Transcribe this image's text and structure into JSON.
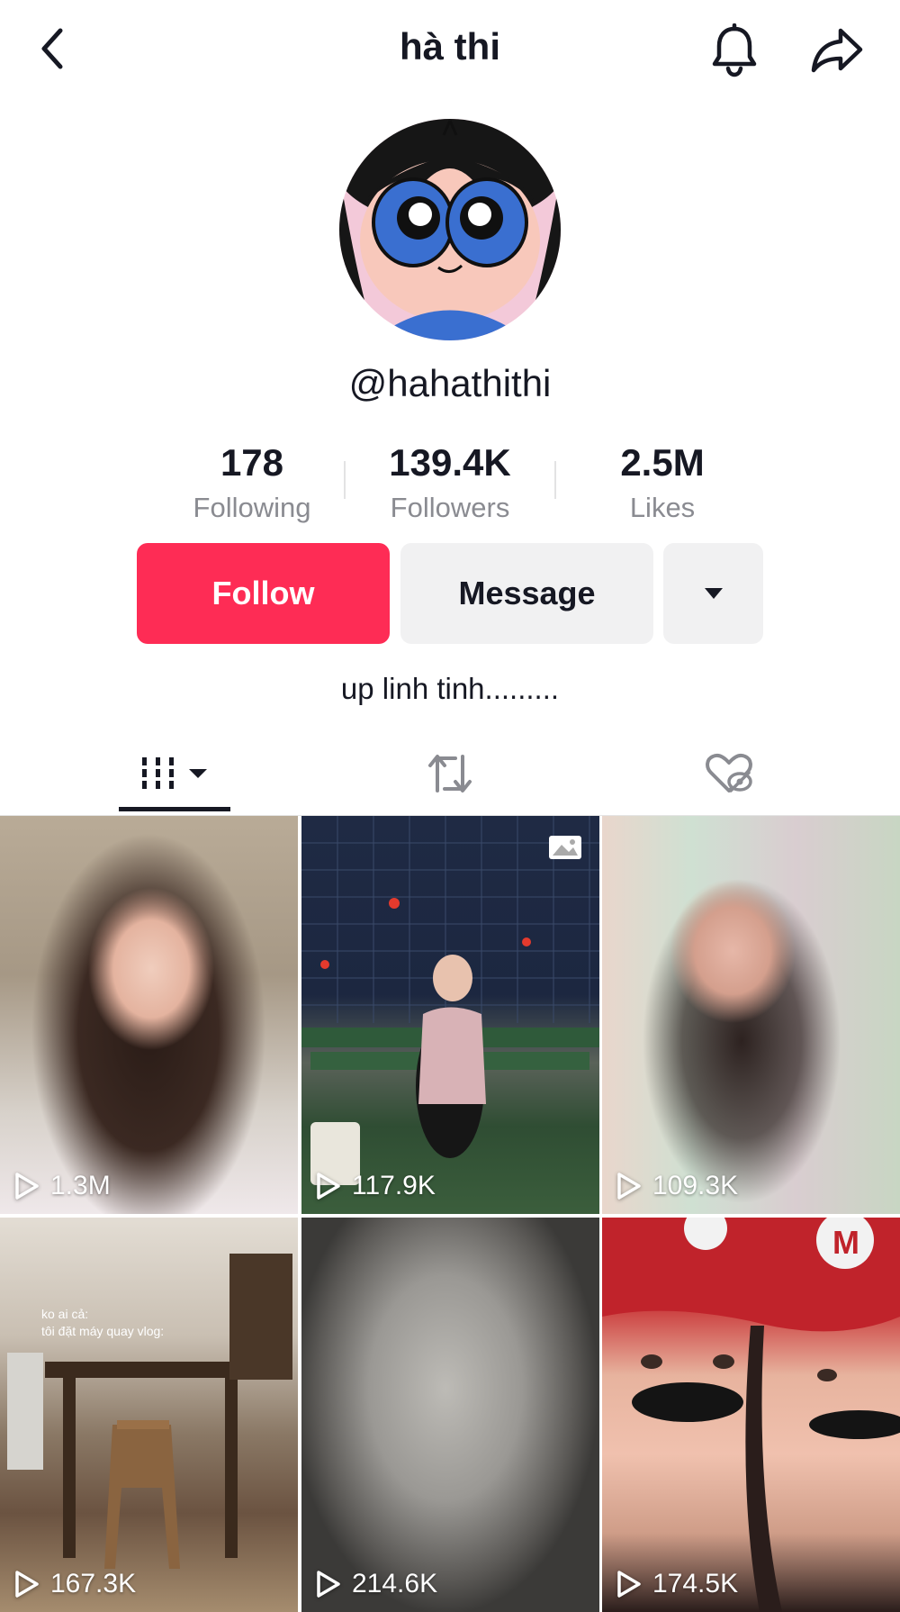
{
  "header": {
    "title": "hà thi",
    "back_icon": "chevron-left-icon",
    "bell_icon": "bell-icon",
    "share_icon": "share-arrow-icon"
  },
  "profile": {
    "handle": "@hahathithi",
    "avatar_icon": "cartoon-avatar",
    "bio": "up linh tinh........."
  },
  "stats": [
    {
      "value": "178",
      "label": "Following"
    },
    {
      "value": "139.4K",
      "label": "Followers"
    },
    {
      "value": "2.5M",
      "label": "Likes"
    }
  ],
  "actions": {
    "follow_label": "Follow",
    "message_label": "Message",
    "more_icon": "caret-down-icon"
  },
  "tabs": [
    {
      "name": "videos",
      "icon": "grid-bars-icon",
      "active": true
    },
    {
      "name": "reposts",
      "icon": "repost-icon",
      "active": false
    },
    {
      "name": "liked",
      "icon": "heart-hidden-icon",
      "active": false
    }
  ],
  "videos": [
    {
      "views": "1.3M"
    },
    {
      "views": "117.9K",
      "photo_icon": "photo-icon"
    },
    {
      "views": "109.3K"
    },
    {
      "views": "167.3K",
      "caption_line1": "ko ai cả:",
      "caption_line2": "tôi đặt máy quay vlog:"
    },
    {
      "views": "214.6K"
    },
    {
      "views": "174.5K"
    }
  ],
  "colors": {
    "accent": "#fe2c55",
    "secondary_button": "#f1f1f2",
    "text_primary": "#161823",
    "text_secondary": "#8a8b91"
  }
}
